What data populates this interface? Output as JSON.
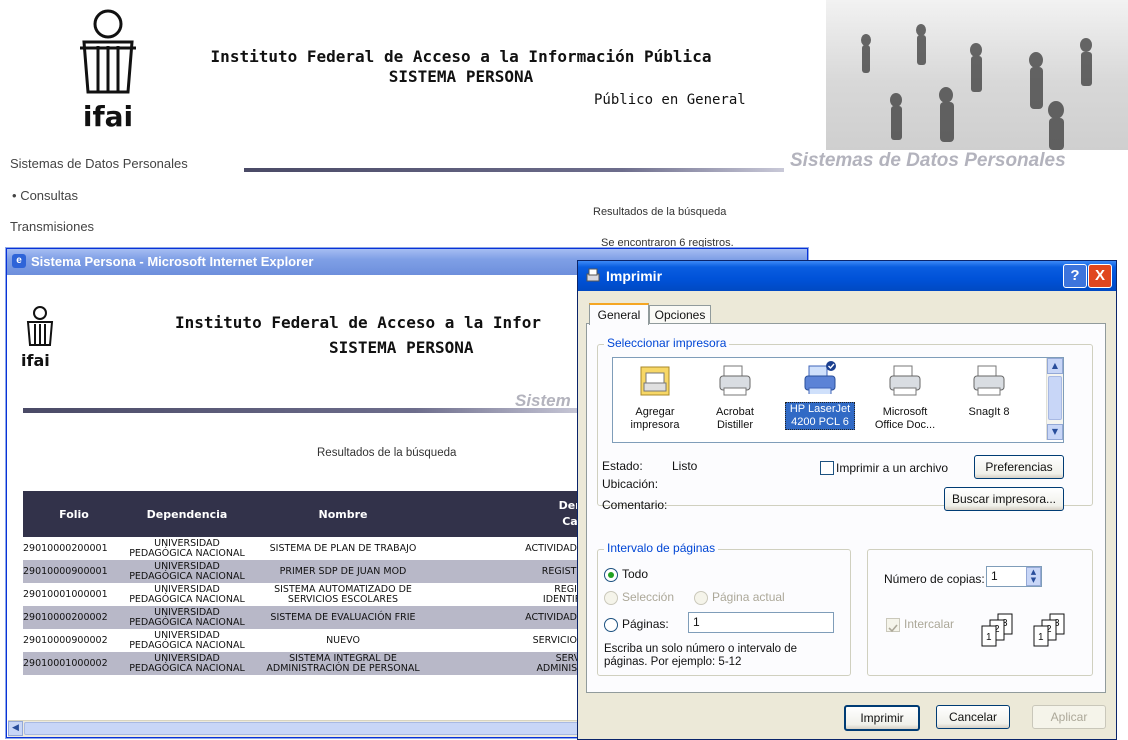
{
  "header": {
    "logo_text": "ifai",
    "title_line1": "Instituto Federal de Acceso a la Información Pública",
    "title_line2": "SISTEMA PERSONA",
    "audience": "Público en General"
  },
  "nav": {
    "section_link": "Sistemas de Datos Personales",
    "section_banner": "Sistemas de Datos Personales",
    "item_consultas": "Consultas",
    "item_transmisiones": "Transmisiones"
  },
  "background_page": {
    "results_title": "Resultados de la búsqueda",
    "results_count": "Se encontraron 6 registros."
  },
  "ie_window": {
    "title": "Sistema Persona - Microsoft Internet Explorer",
    "page_title_line1": "Instituto Federal de Acceso a la Infor",
    "page_title_line2": "SISTEMA PERSONA",
    "banner_partial": "Sistem",
    "results_title": "Resultados de la búsqueda",
    "columns": [
      "Folio",
      "Dependencia",
      "Nombre",
      "Den\nCat"
    ],
    "rows": [
      {
        "folio": "29010000200001",
        "dependencia": "UNIVERSIDAD\nPEDAGÓGICA NACIONAL",
        "nombre": "SISTEMA DE PLAN DE TRABAJO",
        "categoria": "ACTIVIDADE"
      },
      {
        "folio": "29010000900001",
        "dependencia": "UNIVERSIDAD\nPEDAGÓGICA NACIONAL",
        "nombre": "PRIMER SDP DE JUAN MOD",
        "categoria": "REGISTR"
      },
      {
        "folio": "29010001000001",
        "dependencia": "UNIVERSIDAD\nPEDAGÓGICA NACIONAL",
        "nombre": "SISTEMA AUTOMATIZADO DE\nSERVICIOS ESCOLARES",
        "categoria": "REGIS\nIDENTIFI"
      },
      {
        "folio": "29010000200002",
        "dependencia": "UNIVERSIDAD\nPEDAGÓGICA NACIONAL",
        "nombre": "SISTEMA DE EVALUACIÓN FRIE",
        "categoria": "ACTIVIDADE"
      },
      {
        "folio": "29010000900002",
        "dependencia": "UNIVERSIDAD\nPEDAGÓGICA NACIONAL",
        "nombre": "NUEVO",
        "categoria": "SERVICIOS"
      },
      {
        "folio": "29010001000002",
        "dependencia": "UNIVERSIDAD\nPEDAGÓGICA NACIONAL",
        "nombre": "SISTEMA INTEGRAL DE\nADMINISTRACIÓN DE PERSONAL",
        "categoria": "SERVI\nADMINIST"
      }
    ]
  },
  "print_dialog": {
    "title": "Imprimir",
    "help_button": "?",
    "close_button": "X",
    "tabs": [
      "General",
      "Opciones"
    ],
    "printer_group_label": "Seleccionar impresora",
    "printers": [
      {
        "name": "Agregar\nimpresora",
        "selected": false
      },
      {
        "name": "Acrobat\nDistiller",
        "selected": false
      },
      {
        "name": "HP LaserJet\n4200 PCL 6",
        "selected": true
      },
      {
        "name": "Microsoft\nOffice Doc...",
        "selected": false
      },
      {
        "name": "SnagIt 8",
        "selected": false
      }
    ],
    "status_label": "Estado:",
    "status_value": "Listo",
    "location_label": "Ubicación:",
    "comment_label": "Comentario:",
    "print_to_file": "Imprimir a un archivo",
    "preferences_button": "Preferencias",
    "find_printer_button": "Buscar impresora...",
    "page_range_label": "Intervalo de páginas",
    "range_all": "Todo",
    "range_selection": "Selección",
    "range_current": "Página actual",
    "range_pages": "Páginas:",
    "pages_value": "1",
    "range_hint": "Escriba un solo número o intervalo de\npáginas. Por ejemplo: 5-12",
    "copies_label": "Número de copias:",
    "copies_value": "1",
    "collate_label": "Intercalar",
    "print_button": "Imprimir",
    "cancel_button": "Cancelar",
    "apply_button": "Aplicar"
  },
  "colors": {
    "table_header": "#32324a",
    "alt_row": "#b8b8c8",
    "xp_title_blue": "#0052d8",
    "group_label_blue": "#0046d5",
    "selection_blue": "#316ac5"
  }
}
